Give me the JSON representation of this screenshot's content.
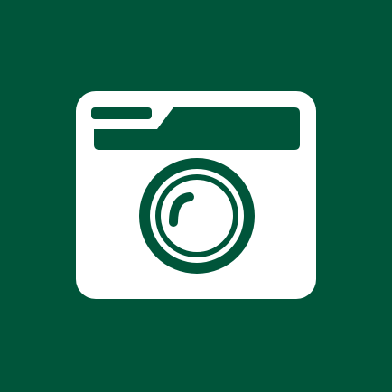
{
  "app_icon": {
    "icon": "camera-icon",
    "colors": {
      "background": "#00553A",
      "foreground": "#FFFFFF"
    }
  }
}
